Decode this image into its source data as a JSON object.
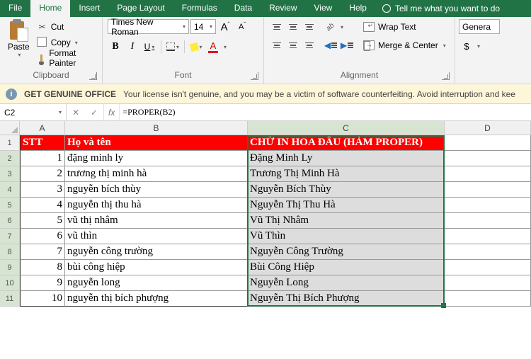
{
  "tabs": {
    "file": "File",
    "home": "Home",
    "insert": "Insert",
    "pagelayout": "Page Layout",
    "formulas": "Formulas",
    "data": "Data",
    "review": "Review",
    "view": "View",
    "help": "Help",
    "tellme": "Tell me what you want to do"
  },
  "clipboard": {
    "paste": "Paste",
    "cut": "Cut",
    "copy": "Copy",
    "painter": "Format Painter",
    "label": "Clipboard"
  },
  "font": {
    "name": "Times New Roman",
    "size": "14",
    "growA": "A",
    "shrinkA": "A",
    "B": "B",
    "I": "I",
    "U": "U",
    "A": "A",
    "label": "Font"
  },
  "align": {
    "wrap": "Wrap Text",
    "merge": "Merge & Center",
    "label": "Alignment"
  },
  "number": {
    "format": "Genera",
    "sym": "$",
    "label": ""
  },
  "warn": {
    "title": "GET GENUINE OFFICE",
    "msg": "Your license isn't genuine, and you may be a victim of software counterfeiting. Avoid interruption and kee"
  },
  "namebox": "C2",
  "fx": "fx",
  "formula": "=PROPER(B2)",
  "cols": [
    "A",
    "B",
    "C",
    "D"
  ],
  "headers": {
    "stt": "STT",
    "name": "Họ và tên",
    "proper": "CHỮ IN HOA ĐẦU (HÀM PROPER)"
  },
  "rows": [
    {
      "n": "1",
      "stt": "1",
      "name": "đặng minh ly",
      "proper": "Đặng Minh Ly"
    },
    {
      "n": "2",
      "stt": "2",
      "name": "trương thị minh hà",
      "proper": "Trương Thị Minh Hà"
    },
    {
      "n": "3",
      "stt": "3",
      "name": "nguyễn bích thùy",
      "proper": "Nguyễn Bích Thùy"
    },
    {
      "n": "4",
      "stt": "4",
      "name": "nguyễn thị thu hà",
      "proper": "Nguyễn Thị Thu Hà"
    },
    {
      "n": "5",
      "stt": "5",
      "name": "vũ thị nhâm",
      "proper": "Vũ Thị Nhâm"
    },
    {
      "n": "6",
      "stt": "6",
      "name": "vũ thìn",
      "proper": "Vũ Thìn"
    },
    {
      "n": "7",
      "stt": "7",
      "name": "nguyễn công trường",
      "proper": "Nguyễn Công Trường"
    },
    {
      "n": "8",
      "stt": "8",
      "name": "bùi công hiệp",
      "proper": "Bùi Công Hiệp"
    },
    {
      "n": "9",
      "stt": "9",
      "name": "nguyễn long",
      "proper": "Nguyễn Long"
    },
    {
      "n": "10",
      "stt": "10",
      "name": "nguyễn thị bích phượng",
      "proper": "Nguyễn Thị Bích Phượng"
    }
  ]
}
